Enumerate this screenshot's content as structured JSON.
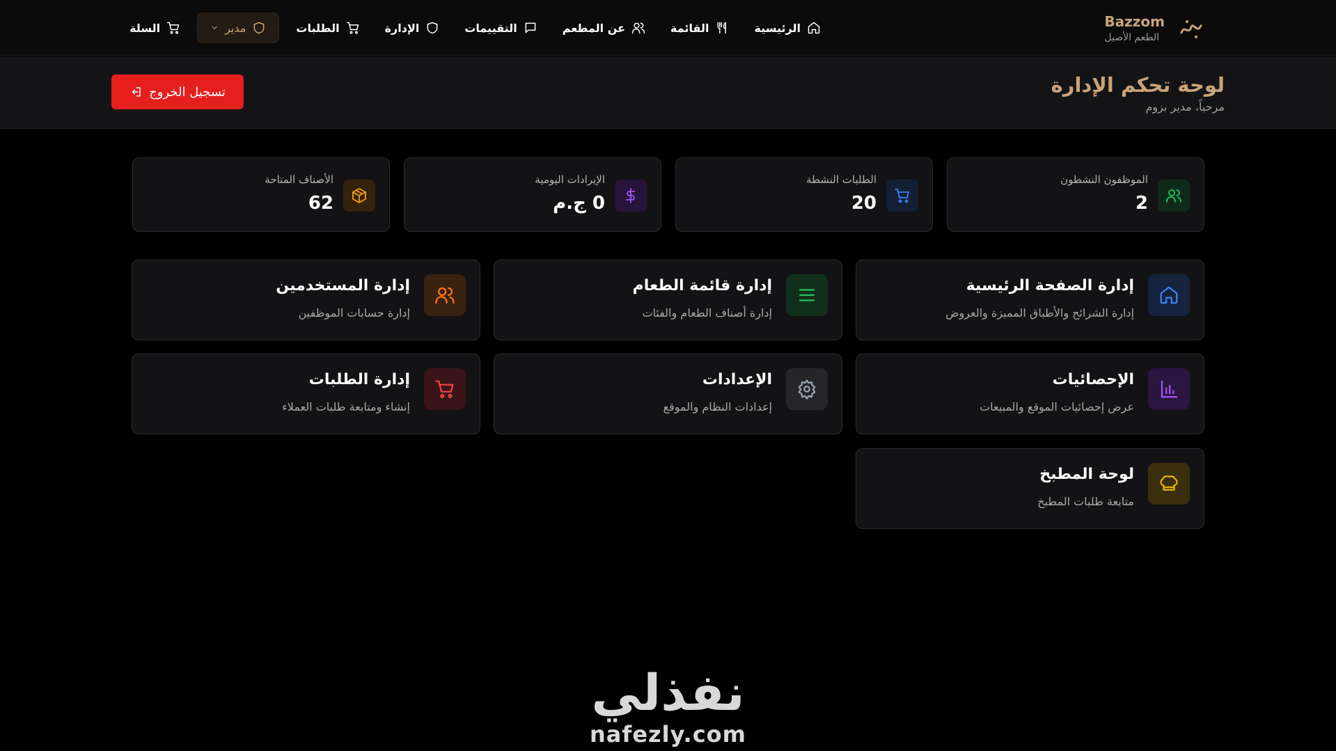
{
  "brand": {
    "name": "Bazzom",
    "tagline": "الطعم الأصيل"
  },
  "nav": {
    "home": "الرئيسية",
    "menu": "القائمة",
    "about": "عن المطعم",
    "reviews": "التقييمات",
    "admin": "الإدارة",
    "orders": "الطلبات",
    "role": "مدير",
    "cart": "السلة"
  },
  "header": {
    "title": "لوحة تحكم الإدارة",
    "subtitle": "مرحباً، مدير بزوم",
    "logout": "تسجيل الخروج"
  },
  "stats": [
    {
      "label": "الموظفون النشطون",
      "value": "2",
      "icon": "users-icon",
      "color": "#22c55e"
    },
    {
      "label": "الطلبات النشطة",
      "value": "20",
      "icon": "cart-icon",
      "color": "#3b82f6"
    },
    {
      "label": "الإيرادات اليومية",
      "value": "0 ج.م",
      "icon": "dollar-icon",
      "color": "#a855f7"
    },
    {
      "label": "الأصناف المتاحة",
      "value": "62",
      "icon": "package-icon",
      "color": "#f59e0b"
    }
  ],
  "cards": [
    {
      "title": "إدارة الصفحة الرئيسية",
      "desc": "إدارة الشرائح والأطباق المميزة والعروض",
      "icon": "home-icon",
      "color": "#3b82f6"
    },
    {
      "title": "إدارة قائمة الطعام",
      "desc": "إدارة أصناف الطعام والفئات",
      "icon": "list-icon",
      "color": "#22c55e"
    },
    {
      "title": "إدارة المستخدمين",
      "desc": "إدارة حسابات الموظفين",
      "icon": "users-icon",
      "color": "#f97316"
    },
    {
      "title": "الإحصائيات",
      "desc": "عرض إحصائيات الموقع والمبيعات",
      "icon": "bar-chart-icon",
      "color": "#a855f7"
    },
    {
      "title": "الإعدادات",
      "desc": "إعدادات النظام والموقع",
      "icon": "gear-icon",
      "color": "#9ca3af"
    },
    {
      "title": "إدارة الطلبات",
      "desc": "إنشاء ومتابعة طلبات العملاء",
      "icon": "cart-icon",
      "color": "#ef4444"
    },
    {
      "title": "لوحة المطبخ",
      "desc": "متابعة طلبات المطبخ",
      "icon": "chef-hat-icon",
      "color": "#eab308"
    }
  ],
  "watermark": {
    "arabic": "نفذلي",
    "latin": "nafezly.com"
  }
}
